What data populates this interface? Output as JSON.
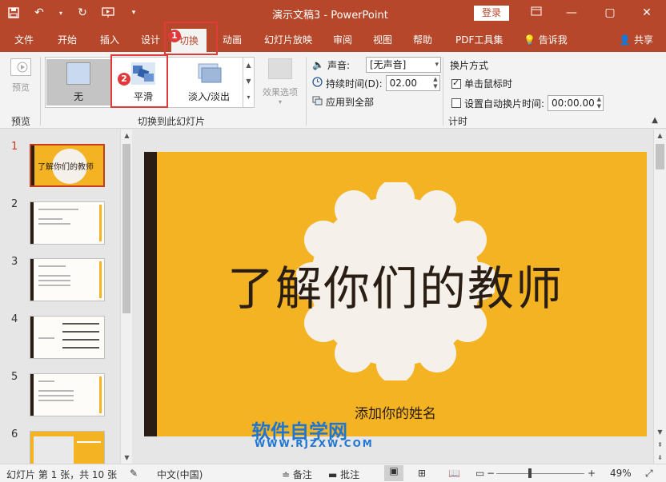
{
  "window": {
    "title": "演示文稿3  -  PowerPoint",
    "login": "登录",
    "controls": {
      "minimize": "—",
      "restore": "▢",
      "close": "✕"
    }
  },
  "tabs": [
    "文件",
    "开始",
    "插入",
    "设计",
    "切换",
    "动画",
    "幻灯片放映",
    "审阅",
    "视图",
    "帮助",
    "PDF工具集",
    "告诉我"
  ],
  "share": "共享",
  "ribbon": {
    "preview": {
      "label": "预览",
      "group": "预览"
    },
    "transitions": {
      "group": "切换到此幻灯片",
      "items": [
        "无",
        "平滑",
        "淡入/淡出"
      ],
      "effect_options": "效果选项"
    },
    "timing": {
      "group": "计时",
      "sound_label": "声音:",
      "sound_value": "[无声音]",
      "duration_label": "持续时间(D):",
      "duration_value": "02.00",
      "apply_all": "应用到全部",
      "advance_title": "换片方式",
      "on_click": "单击鼠标时",
      "on_click_checked": true,
      "after_label": "设置自动换片时间:",
      "after_checked": false,
      "after_value": "00:00.00"
    }
  },
  "thumbnails": {
    "numbers": [
      "1",
      "2",
      "3",
      "4",
      "5",
      "6"
    ],
    "first_title": "了解你们的教师"
  },
  "slide": {
    "title": "了解你们的教师",
    "subtitle": "添加你的姓名"
  },
  "watermark": {
    "line1": "软件自学网",
    "line2": "WWW.RJZXW.COM"
  },
  "annotations": {
    "step1": "1",
    "step2": "2"
  },
  "status": {
    "slide_info": "幻灯片 第 1 张，共 10 张",
    "language": "中文(中国)",
    "notes": "备注",
    "comments": "批注",
    "zoom": "49%"
  },
  "colors": {
    "brand": "#b7472a",
    "slide_bg": "#f3b322",
    "slide_dark": "#2a1e14",
    "highlight": "#e03a3a"
  }
}
